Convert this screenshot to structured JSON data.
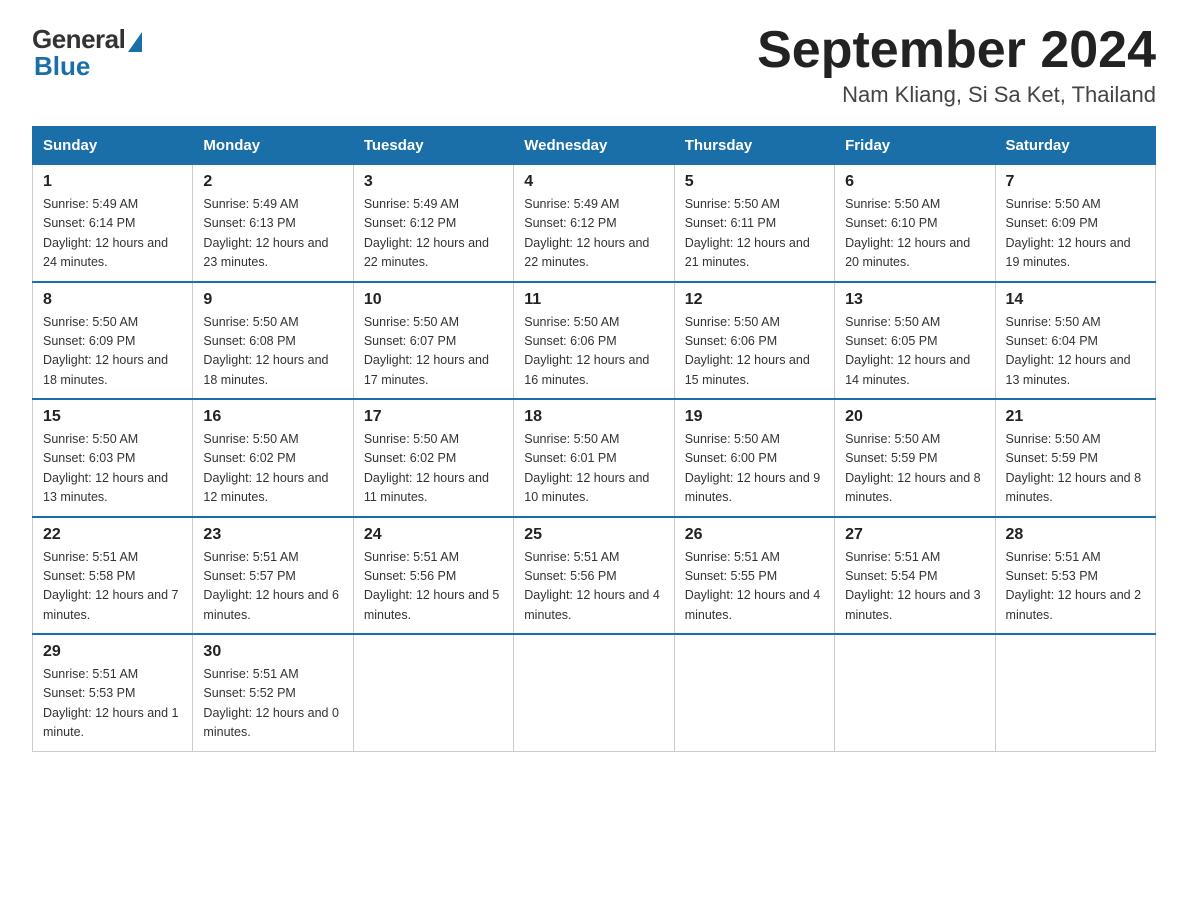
{
  "header": {
    "logo_general": "General",
    "logo_blue": "Blue",
    "month_year": "September 2024",
    "location": "Nam Kliang, Si Sa Ket, Thailand"
  },
  "weekdays": [
    "Sunday",
    "Monday",
    "Tuesday",
    "Wednesday",
    "Thursday",
    "Friday",
    "Saturday"
  ],
  "weeks": [
    [
      {
        "day": "1",
        "sunrise": "5:49 AM",
        "sunset": "6:14 PM",
        "daylight": "12 hours and 24 minutes."
      },
      {
        "day": "2",
        "sunrise": "5:49 AM",
        "sunset": "6:13 PM",
        "daylight": "12 hours and 23 minutes."
      },
      {
        "day": "3",
        "sunrise": "5:49 AM",
        "sunset": "6:12 PM",
        "daylight": "12 hours and 22 minutes."
      },
      {
        "day": "4",
        "sunrise": "5:49 AM",
        "sunset": "6:12 PM",
        "daylight": "12 hours and 22 minutes."
      },
      {
        "day": "5",
        "sunrise": "5:50 AM",
        "sunset": "6:11 PM",
        "daylight": "12 hours and 21 minutes."
      },
      {
        "day": "6",
        "sunrise": "5:50 AM",
        "sunset": "6:10 PM",
        "daylight": "12 hours and 20 minutes."
      },
      {
        "day": "7",
        "sunrise": "5:50 AM",
        "sunset": "6:09 PM",
        "daylight": "12 hours and 19 minutes."
      }
    ],
    [
      {
        "day": "8",
        "sunrise": "5:50 AM",
        "sunset": "6:09 PM",
        "daylight": "12 hours and 18 minutes."
      },
      {
        "day": "9",
        "sunrise": "5:50 AM",
        "sunset": "6:08 PM",
        "daylight": "12 hours and 18 minutes."
      },
      {
        "day": "10",
        "sunrise": "5:50 AM",
        "sunset": "6:07 PM",
        "daylight": "12 hours and 17 minutes."
      },
      {
        "day": "11",
        "sunrise": "5:50 AM",
        "sunset": "6:06 PM",
        "daylight": "12 hours and 16 minutes."
      },
      {
        "day": "12",
        "sunrise": "5:50 AM",
        "sunset": "6:06 PM",
        "daylight": "12 hours and 15 minutes."
      },
      {
        "day": "13",
        "sunrise": "5:50 AM",
        "sunset": "6:05 PM",
        "daylight": "12 hours and 14 minutes."
      },
      {
        "day": "14",
        "sunrise": "5:50 AM",
        "sunset": "6:04 PM",
        "daylight": "12 hours and 13 minutes."
      }
    ],
    [
      {
        "day": "15",
        "sunrise": "5:50 AM",
        "sunset": "6:03 PM",
        "daylight": "12 hours and 13 minutes."
      },
      {
        "day": "16",
        "sunrise": "5:50 AM",
        "sunset": "6:02 PM",
        "daylight": "12 hours and 12 minutes."
      },
      {
        "day": "17",
        "sunrise": "5:50 AM",
        "sunset": "6:02 PM",
        "daylight": "12 hours and 11 minutes."
      },
      {
        "day": "18",
        "sunrise": "5:50 AM",
        "sunset": "6:01 PM",
        "daylight": "12 hours and 10 minutes."
      },
      {
        "day": "19",
        "sunrise": "5:50 AM",
        "sunset": "6:00 PM",
        "daylight": "12 hours and 9 minutes."
      },
      {
        "day": "20",
        "sunrise": "5:50 AM",
        "sunset": "5:59 PM",
        "daylight": "12 hours and 8 minutes."
      },
      {
        "day": "21",
        "sunrise": "5:50 AM",
        "sunset": "5:59 PM",
        "daylight": "12 hours and 8 minutes."
      }
    ],
    [
      {
        "day": "22",
        "sunrise": "5:51 AM",
        "sunset": "5:58 PM",
        "daylight": "12 hours and 7 minutes."
      },
      {
        "day": "23",
        "sunrise": "5:51 AM",
        "sunset": "5:57 PM",
        "daylight": "12 hours and 6 minutes."
      },
      {
        "day": "24",
        "sunrise": "5:51 AM",
        "sunset": "5:56 PM",
        "daylight": "12 hours and 5 minutes."
      },
      {
        "day": "25",
        "sunrise": "5:51 AM",
        "sunset": "5:56 PM",
        "daylight": "12 hours and 4 minutes."
      },
      {
        "day": "26",
        "sunrise": "5:51 AM",
        "sunset": "5:55 PM",
        "daylight": "12 hours and 4 minutes."
      },
      {
        "day": "27",
        "sunrise": "5:51 AM",
        "sunset": "5:54 PM",
        "daylight": "12 hours and 3 minutes."
      },
      {
        "day": "28",
        "sunrise": "5:51 AM",
        "sunset": "5:53 PM",
        "daylight": "12 hours and 2 minutes."
      }
    ],
    [
      {
        "day": "29",
        "sunrise": "5:51 AM",
        "sunset": "5:53 PM",
        "daylight": "12 hours and 1 minute."
      },
      {
        "day": "30",
        "sunrise": "5:51 AM",
        "sunset": "5:52 PM",
        "daylight": "12 hours and 0 minutes."
      },
      null,
      null,
      null,
      null,
      null
    ]
  ]
}
